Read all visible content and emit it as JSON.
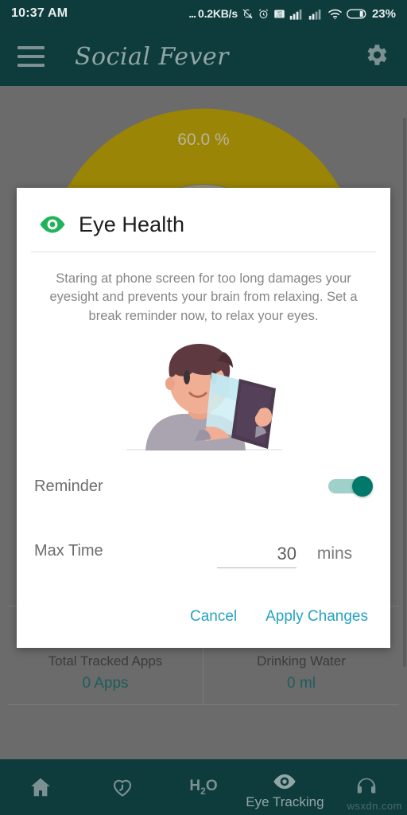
{
  "status_bar": {
    "time": "10:37 AM",
    "network_speed": "0.2KB/s",
    "leading_dots": "...",
    "battery_percent": "23%",
    "icons": [
      "mute-icon",
      "alarm-icon",
      "volte-icon",
      "signal-sim1-icon",
      "signal-sim2-icon",
      "wifi-icon",
      "battery-icon"
    ]
  },
  "app_bar": {
    "menu_icon": "hamburger-menu-icon",
    "title": "Social Fever",
    "settings_icon": "gear-icon"
  },
  "background": {
    "gauge": {
      "value_label": "60.0 %",
      "green_color": "#1f7a3f",
      "yellow_color": "#9a8506",
      "red_color": "#a5302c"
    },
    "cards": [
      {
        "icon": "stopwatch-icon",
        "title": "Total Tracked Apps",
        "value": "0 Apps"
      },
      {
        "icon": "h2o-icon",
        "title": "Drinking Water",
        "value": "0 ml"
      }
    ]
  },
  "dialog": {
    "icon": "eye-icon",
    "icon_color": "#21b35a",
    "title": "Eye Health",
    "description": "Staring at phone screen for too long damages your eyesight and prevents your brain from relaxing. Set a break reminder now, to relax your eyes.",
    "illustration": "boy-reading-tablet-illustration",
    "reminder": {
      "label": "Reminder",
      "enabled": true,
      "accent_color": "#00796b"
    },
    "max_time": {
      "label": "Max Time",
      "value": "30",
      "placeholder": "30",
      "unit": "mins"
    },
    "actions": {
      "cancel_label": "Cancel",
      "apply_label": "Apply Changes",
      "color": "#26a3bf"
    }
  },
  "bottom_nav": {
    "items": [
      {
        "icon": "home-icon",
        "label": ""
      },
      {
        "icon": "heart-clock-icon",
        "label": ""
      },
      {
        "icon": "h2o-icon",
        "label": ""
      },
      {
        "icon": "eye-icon",
        "label": "Eye Tracking"
      },
      {
        "icon": "headphones-icon",
        "label": ""
      }
    ]
  },
  "watermark": "wsxdn.com"
}
